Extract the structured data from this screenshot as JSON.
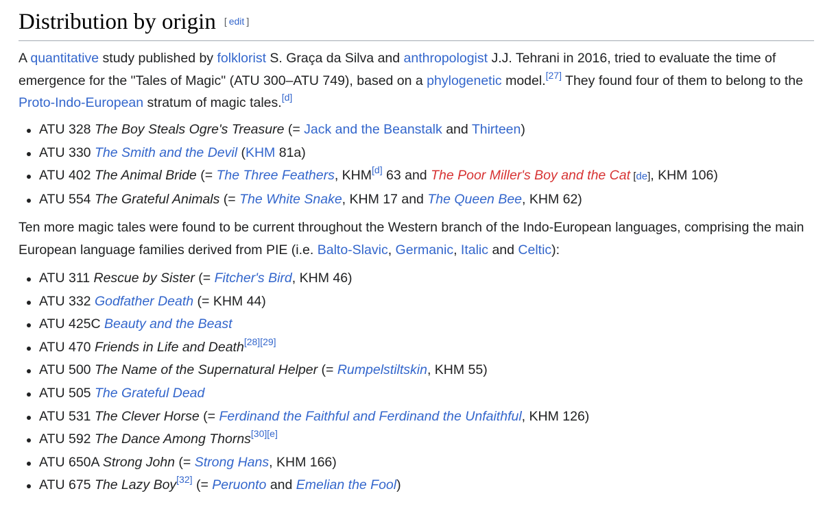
{
  "section": {
    "title": "Distribution by origin",
    "edit_bracket_open": "[",
    "edit_label": "edit",
    "edit_bracket_close": "]"
  },
  "para1": {
    "t0": "A ",
    "l_quant": "quantitative",
    "t1": " study published by ",
    "l_folk": "folklorist",
    "t2": " S. Graça da Silva and ",
    "l_anth": "anthropologist",
    "t3": " J.J. Tehrani in 2016, tried to evaluate the time of emergence for the \"Tales of Magic\" (ATU 300–ATU 749), based on a ",
    "l_phylo": "phylogenetic",
    "t4": " model.",
    "ref27": "[27]",
    "t5": " They found four of them to belong to the ",
    "l_pie": "Proto-Indo-European",
    "t6": " stratum of magic tales.",
    "ref_d": "[d]"
  },
  "list1": {
    "i0": {
      "code": "ATU 328 ",
      "title": "The Boy Steals Ogre's Treasure",
      "a": " (= ",
      "link1": "Jack and the Beanstalk",
      "b": " and ",
      "link2": "Thirteen",
      "c": ")"
    },
    "i1": {
      "code": "ATU 330 ",
      "title": "The Smith and the Devil",
      "a": " (",
      "link1": "KHM",
      "b": " 81a)"
    },
    "i2": {
      "code": "ATU 402 ",
      "title": "The Animal Bride",
      "a": " (= ",
      "link1": "The Three Feathers",
      "b": ", KHM",
      "ref": "[d]",
      "c": " 63 and ",
      "red": "The Poor Miller's Boy and the Cat",
      "il_open": " [",
      "il": "de",
      "il_close": "]",
      "d": ", KHM 106)"
    },
    "i3": {
      "code": "ATU 554 ",
      "title": "The Grateful Animals",
      "a": " (= ",
      "link1": "The White Snake",
      "b": ", KHM 17 and ",
      "link2": "The Queen Bee",
      "c": ", KHM 62)"
    }
  },
  "para2": {
    "t0": "Ten more magic tales were found to be current throughout the Western branch of the Indo-European languages, comprising the main European language families derived from PIE (i.e. ",
    "l_balto": "Balto-Slavic",
    "s1": ", ",
    "l_germ": "Germanic",
    "s2": ", ",
    "l_ital": "Italic",
    "s3": " and ",
    "l_celt": "Celtic",
    "s4": "):"
  },
  "list2": {
    "i0": {
      "code": "ATU 311 ",
      "title": "Rescue by Sister",
      "a": " (= ",
      "link1": "Fitcher's Bird",
      "b": ", KHM 46)"
    },
    "i1": {
      "code": "ATU 332 ",
      "title": "Godfather Death",
      "a": " (= KHM 44)"
    },
    "i2": {
      "code": "ATU 425C ",
      "title": "Beauty and the Beast"
    },
    "i3": {
      "code": "ATU 470 ",
      "title": "Friends in Life and Death",
      "ref1": "[28]",
      "ref2": "[29]"
    },
    "i4": {
      "code": "ATU 500 ",
      "title": "The Name of the Supernatural Helper",
      "a": " (= ",
      "link1": "Rumpelstiltskin",
      "b": ", KHM 55)"
    },
    "i5": {
      "code": "ATU 505 ",
      "title": "The Grateful Dead"
    },
    "i6": {
      "code": "ATU 531 ",
      "title": "The Clever Horse",
      "a": " (= ",
      "link1": "Ferdinand the Faithful and Ferdinand the Unfaithful",
      "b": ", KHM 126)"
    },
    "i7": {
      "code": "ATU 592 ",
      "title": "The Dance Among Thorns",
      "ref1": "[30]",
      "ref2": "[e]"
    },
    "i8": {
      "code": "ATU 650A ",
      "title": "Strong John",
      "a": " (= ",
      "link1": "Strong Hans",
      "b": ", KHM 166)"
    },
    "i9": {
      "code": "ATU 675 ",
      "title": "The Lazy Boy",
      "ref1": "[32]",
      "a": " (= ",
      "link1": "Peruonto",
      "b": " and ",
      "link2": "Emelian the Fool",
      "c": ")"
    }
  }
}
